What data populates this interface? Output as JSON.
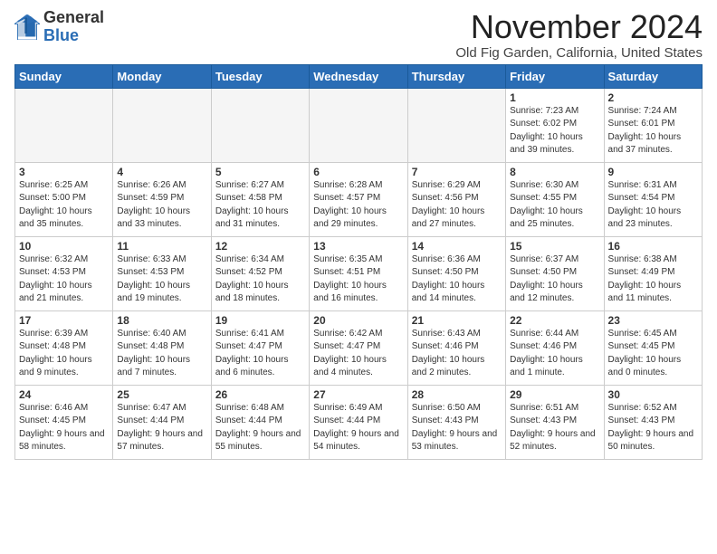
{
  "header": {
    "logo_general": "General",
    "logo_blue": "Blue",
    "month_title": "November 2024",
    "location": "Old Fig Garden, California, United States"
  },
  "weekdays": [
    "Sunday",
    "Monday",
    "Tuesday",
    "Wednesday",
    "Thursday",
    "Friday",
    "Saturday"
  ],
  "weeks": [
    [
      {
        "day": "",
        "empty": true
      },
      {
        "day": "",
        "empty": true
      },
      {
        "day": "",
        "empty": true
      },
      {
        "day": "",
        "empty": true
      },
      {
        "day": "",
        "empty": true
      },
      {
        "day": "1",
        "info": "Sunrise: 7:23 AM\nSunset: 6:02 PM\nDaylight: 10 hours and 39 minutes."
      },
      {
        "day": "2",
        "info": "Sunrise: 7:24 AM\nSunset: 6:01 PM\nDaylight: 10 hours and 37 minutes."
      }
    ],
    [
      {
        "day": "3",
        "info": "Sunrise: 6:25 AM\nSunset: 5:00 PM\nDaylight: 10 hours and 35 minutes."
      },
      {
        "day": "4",
        "info": "Sunrise: 6:26 AM\nSunset: 4:59 PM\nDaylight: 10 hours and 33 minutes."
      },
      {
        "day": "5",
        "info": "Sunrise: 6:27 AM\nSunset: 4:58 PM\nDaylight: 10 hours and 31 minutes."
      },
      {
        "day": "6",
        "info": "Sunrise: 6:28 AM\nSunset: 4:57 PM\nDaylight: 10 hours and 29 minutes."
      },
      {
        "day": "7",
        "info": "Sunrise: 6:29 AM\nSunset: 4:56 PM\nDaylight: 10 hours and 27 minutes."
      },
      {
        "day": "8",
        "info": "Sunrise: 6:30 AM\nSunset: 4:55 PM\nDaylight: 10 hours and 25 minutes."
      },
      {
        "day": "9",
        "info": "Sunrise: 6:31 AM\nSunset: 4:54 PM\nDaylight: 10 hours and 23 minutes."
      }
    ],
    [
      {
        "day": "10",
        "info": "Sunrise: 6:32 AM\nSunset: 4:53 PM\nDaylight: 10 hours and 21 minutes."
      },
      {
        "day": "11",
        "info": "Sunrise: 6:33 AM\nSunset: 4:53 PM\nDaylight: 10 hours and 19 minutes."
      },
      {
        "day": "12",
        "info": "Sunrise: 6:34 AM\nSunset: 4:52 PM\nDaylight: 10 hours and 18 minutes."
      },
      {
        "day": "13",
        "info": "Sunrise: 6:35 AM\nSunset: 4:51 PM\nDaylight: 10 hours and 16 minutes."
      },
      {
        "day": "14",
        "info": "Sunrise: 6:36 AM\nSunset: 4:50 PM\nDaylight: 10 hours and 14 minutes."
      },
      {
        "day": "15",
        "info": "Sunrise: 6:37 AM\nSunset: 4:50 PM\nDaylight: 10 hours and 12 minutes."
      },
      {
        "day": "16",
        "info": "Sunrise: 6:38 AM\nSunset: 4:49 PM\nDaylight: 10 hours and 11 minutes."
      }
    ],
    [
      {
        "day": "17",
        "info": "Sunrise: 6:39 AM\nSunset: 4:48 PM\nDaylight: 10 hours and 9 minutes."
      },
      {
        "day": "18",
        "info": "Sunrise: 6:40 AM\nSunset: 4:48 PM\nDaylight: 10 hours and 7 minutes."
      },
      {
        "day": "19",
        "info": "Sunrise: 6:41 AM\nSunset: 4:47 PM\nDaylight: 10 hours and 6 minutes."
      },
      {
        "day": "20",
        "info": "Sunrise: 6:42 AM\nSunset: 4:47 PM\nDaylight: 10 hours and 4 minutes."
      },
      {
        "day": "21",
        "info": "Sunrise: 6:43 AM\nSunset: 4:46 PM\nDaylight: 10 hours and 2 minutes."
      },
      {
        "day": "22",
        "info": "Sunrise: 6:44 AM\nSunset: 4:46 PM\nDaylight: 10 hours and 1 minute."
      },
      {
        "day": "23",
        "info": "Sunrise: 6:45 AM\nSunset: 4:45 PM\nDaylight: 10 hours and 0 minutes."
      }
    ],
    [
      {
        "day": "24",
        "info": "Sunrise: 6:46 AM\nSunset: 4:45 PM\nDaylight: 9 hours and 58 minutes."
      },
      {
        "day": "25",
        "info": "Sunrise: 6:47 AM\nSunset: 4:44 PM\nDaylight: 9 hours and 57 minutes."
      },
      {
        "day": "26",
        "info": "Sunrise: 6:48 AM\nSunset: 4:44 PM\nDaylight: 9 hours and 55 minutes."
      },
      {
        "day": "27",
        "info": "Sunrise: 6:49 AM\nSunset: 4:44 PM\nDaylight: 9 hours and 54 minutes."
      },
      {
        "day": "28",
        "info": "Sunrise: 6:50 AM\nSunset: 4:43 PM\nDaylight: 9 hours and 53 minutes."
      },
      {
        "day": "29",
        "info": "Sunrise: 6:51 AM\nSunset: 4:43 PM\nDaylight: 9 hours and 52 minutes."
      },
      {
        "day": "30",
        "info": "Sunrise: 6:52 AM\nSunset: 4:43 PM\nDaylight: 9 hours and 50 minutes."
      }
    ]
  ],
  "colors": {
    "header_bg": "#2a6db5",
    "shaded_row": "#f0f0f0",
    "empty_cell": "#f5f5f5"
  }
}
